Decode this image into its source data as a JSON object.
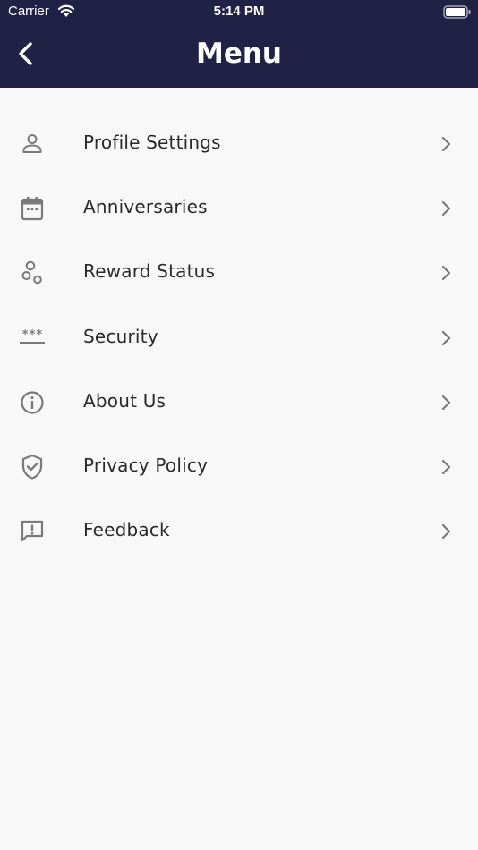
{
  "status_bar": {
    "carrier": "Carrier",
    "time": "5:14 PM"
  },
  "nav": {
    "title": "Menu",
    "back_icon": "chevron-left-icon"
  },
  "colors": {
    "header_bg": "#1f2244",
    "page_bg": "#f8f8f8",
    "icon": "#7a7a7a",
    "text": "#2a2a2a"
  },
  "menu": {
    "items": [
      {
        "label": "Profile Settings",
        "icon": "person-icon"
      },
      {
        "label": "Anniversaries",
        "icon": "calendar-icon"
      },
      {
        "label": "Reward Status",
        "icon": "bubbles-icon"
      },
      {
        "label": "Security",
        "icon": "password-icon"
      },
      {
        "label": "About Us",
        "icon": "info-icon"
      },
      {
        "label": "Privacy Policy",
        "icon": "shield-check-icon"
      },
      {
        "label": "Feedback",
        "icon": "feedback-icon"
      }
    ]
  }
}
